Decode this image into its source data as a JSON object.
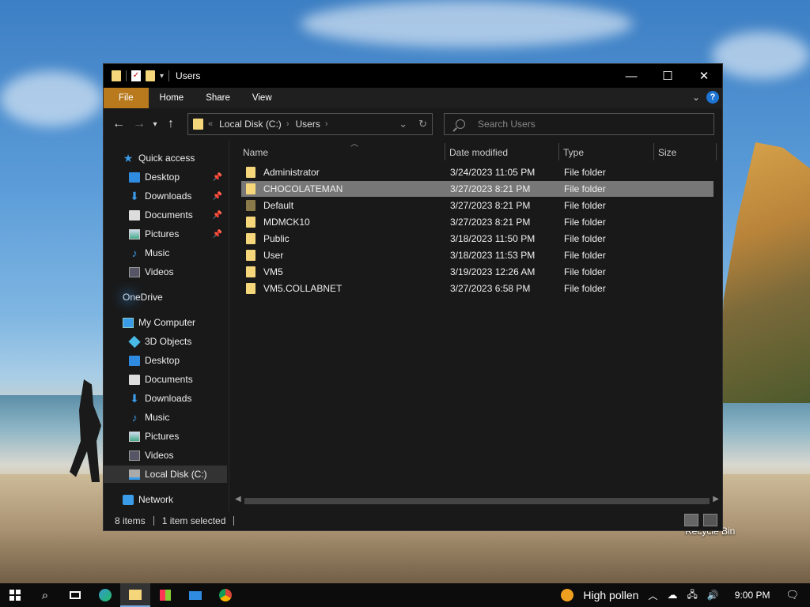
{
  "window": {
    "title": "Users",
    "controls": {
      "minimize": "—",
      "maximize": "☐",
      "close": "✕"
    }
  },
  "ribbon": {
    "tabs": [
      "File",
      "Home",
      "Share",
      "View"
    ],
    "help": "?"
  },
  "address": {
    "overflow": "«",
    "crumbs": [
      "Local Disk (C:)",
      "Users"
    ],
    "sep": "›"
  },
  "search": {
    "placeholder": "Search Users"
  },
  "sidebar": {
    "items": [
      {
        "label": "Quick access",
        "icon": "star-icon"
      },
      {
        "label": "Desktop",
        "icon": "desktop-icon",
        "pinned": true
      },
      {
        "label": "Downloads",
        "icon": "download-icon",
        "pinned": true
      },
      {
        "label": "Documents",
        "icon": "documents-icon",
        "pinned": true
      },
      {
        "label": "Pictures",
        "icon": "pictures-icon",
        "pinned": true
      },
      {
        "label": "Music",
        "icon": "music-icon"
      },
      {
        "label": "Videos",
        "icon": "videos-icon"
      },
      {
        "label": "OneDrive",
        "icon": "onedrive-icon"
      },
      {
        "label": "My Computer",
        "icon": "computer-icon"
      },
      {
        "label": "3D Objects",
        "icon": "3d-objects-icon"
      },
      {
        "label": "Desktop",
        "icon": "desktop-icon"
      },
      {
        "label": "Documents",
        "icon": "documents-icon"
      },
      {
        "label": "Downloads",
        "icon": "download-icon"
      },
      {
        "label": "Music",
        "icon": "music-icon"
      },
      {
        "label": "Pictures",
        "icon": "pictures-icon"
      },
      {
        "label": "Videos",
        "icon": "videos-icon"
      },
      {
        "label": "Local Disk (C:)",
        "icon": "disk-icon",
        "selected": true
      },
      {
        "label": "Network",
        "icon": "network-icon"
      }
    ]
  },
  "columns": {
    "name": "Name",
    "date": "Date modified",
    "type": "Type",
    "size": "Size"
  },
  "files": [
    {
      "name": "Administrator",
      "date": "3/24/2023 11:05 PM",
      "type": "File folder"
    },
    {
      "name": "CHOCOLATEMAN",
      "date": "3/27/2023 8:21 PM",
      "type": "File folder",
      "selected": true
    },
    {
      "name": "Default",
      "date": "3/27/2023 8:21 PM",
      "type": "File folder"
    },
    {
      "name": "MDMCK10",
      "date": "3/27/2023 8:21 PM",
      "type": "File folder"
    },
    {
      "name": "Public",
      "date": "3/18/2023 11:50 PM",
      "type": "File folder"
    },
    {
      "name": "User",
      "date": "3/18/2023 11:53 PM",
      "type": "File folder"
    },
    {
      "name": "VM5",
      "date": "3/19/2023 12:26 AM",
      "type": "File folder"
    },
    {
      "name": "VM5.COLLABNET",
      "date": "3/27/2023 6:58 PM",
      "type": "File folder"
    }
  ],
  "status": {
    "count": "8 items",
    "selection": "1 item selected"
  },
  "desktop": {
    "recycle_bin": "Recycle Bin"
  },
  "taskbar": {
    "weather": "High pollen",
    "time": "9:00 PM"
  },
  "colors": {
    "accent": "#b97a1e",
    "folder": "#f5d67a",
    "selected_row": "#777777"
  }
}
